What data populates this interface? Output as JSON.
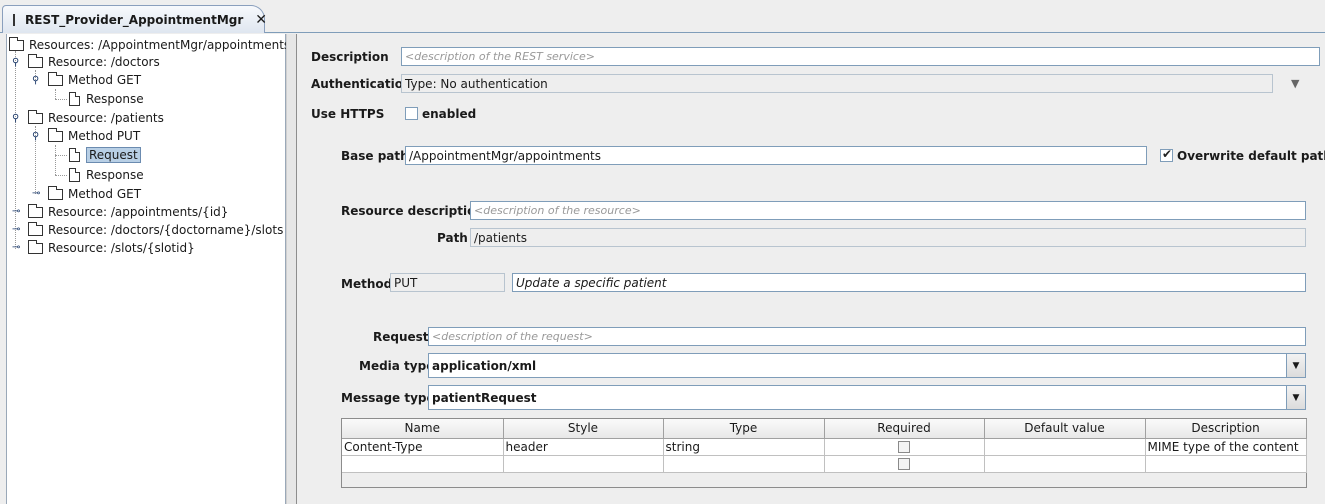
{
  "tab": {
    "title": "REST_Provider_AppointmentMgr",
    "close": "✕"
  },
  "tree": {
    "root": "Resources: /AppointmentMgr/appointments",
    "doctors": "Resource: /doctors",
    "doctors_get": "Method GET",
    "doctors_get_response": "Response",
    "patients": "Resource: /patients",
    "patients_put": "Method PUT",
    "patients_put_request": "Request",
    "patients_put_response": "Response",
    "patients_get": "Method GET",
    "appointments_id": "Resource: /appointments/{id}",
    "doctors_slots": "Resource: /doctors/{doctorname}/slots",
    "slots_id": "Resource: /slots/{slotid}"
  },
  "form": {
    "description_label": "Description",
    "description_placeholder": "<description of the REST service>",
    "authentication_label": "Authentication",
    "authentication_value": "Type: No authentication",
    "use_https_label": "Use HTTPS",
    "https_enabled_label": "enabled",
    "https_enabled": false,
    "base_path_label": "Base path",
    "base_path_value": "/AppointmentMgr/appointments",
    "overwrite_label": "Overwrite default path",
    "overwrite_checked": true,
    "resource_description_label": "Resource description",
    "resource_description_placeholder": "<description of the resource>",
    "path_label": "Path",
    "path_value": "/patients",
    "method_label": "Method",
    "method_value": "PUT",
    "method_description": "Update a specific patient",
    "request_label": "Request",
    "request_placeholder": "<description of the request>",
    "media_type_label": "Media type",
    "media_type_value": "application/xml",
    "message_type_label": "Message type",
    "message_type_value": "patientRequest"
  },
  "table": {
    "columns": [
      "Name",
      "Style",
      "Type",
      "Required",
      "Default value",
      "Description"
    ],
    "rows": [
      {
        "name": "Content-Type",
        "style": "header",
        "type": "string",
        "required": false,
        "default": "",
        "description": "MIME type of the content"
      },
      {
        "name": "",
        "style": "",
        "type": "",
        "required": false,
        "default": "",
        "description": ""
      }
    ]
  },
  "colors": {
    "selection": "#b8cfe5",
    "border": "#7f9db9",
    "background": "#eeeeee"
  }
}
